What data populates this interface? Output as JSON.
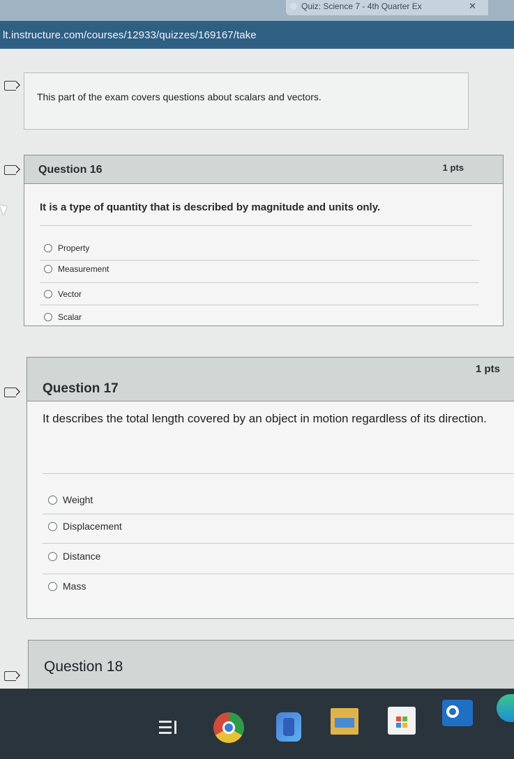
{
  "browser": {
    "tab_title": "Quiz: Science 7 - 4th Quarter Ex",
    "tab_close": "✕",
    "url": "lt.instructure.com/courses/12933/quizzes/169167/take"
  },
  "intro": {
    "text": "This part of the exam covers questions about scalars and vectors."
  },
  "questions": [
    {
      "title": "Question 16",
      "points": "1 pts",
      "text": "It is a type of quantity that is described by magnitude and units only.",
      "options": [
        "Property",
        "Measurement",
        "Vector",
        "Scalar"
      ]
    },
    {
      "title": "Question 17",
      "points": "1 pts",
      "text": "It describes the total length covered by an object in motion regardless of its direction.",
      "options": [
        "Weight",
        "Displacement",
        "Distance",
        "Mass"
      ]
    },
    {
      "title": "Question 18"
    }
  ],
  "taskbar": {
    "icons": [
      "task-view-icon",
      "chrome-icon",
      "files-icon",
      "file-explorer-icon",
      "store-icon",
      "outlook-icon",
      "edge-icon"
    ]
  }
}
